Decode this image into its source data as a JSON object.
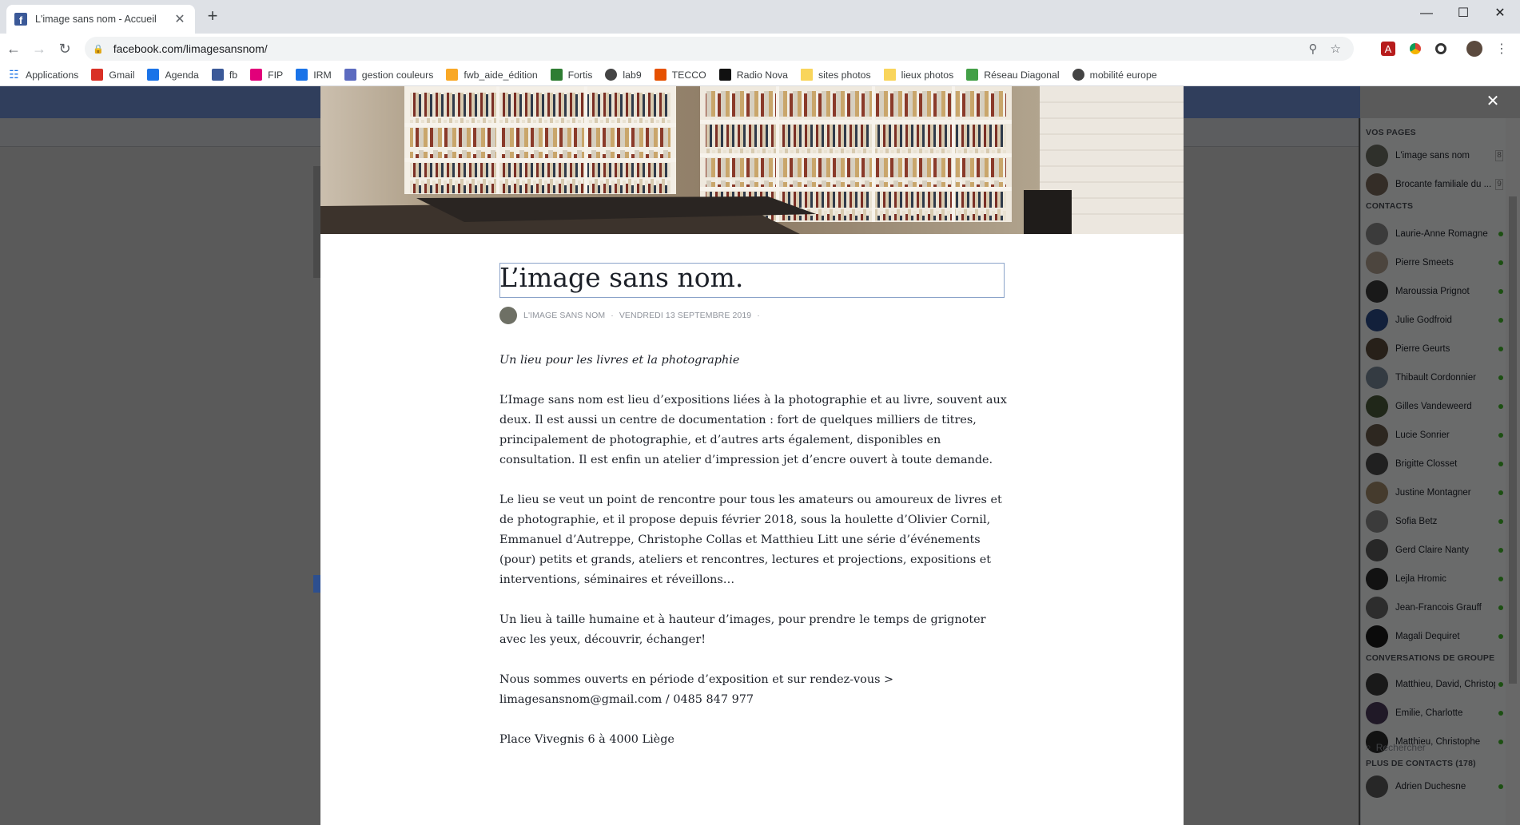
{
  "browser": {
    "tab_title": "L'image sans nom - Accueil",
    "tab_close": "✕",
    "new_tab": "+",
    "url": "facebook.com/limagesansnom/",
    "window_controls": [
      "—",
      "☐",
      "✕"
    ]
  },
  "bookmarks": [
    {
      "label": "Applications",
      "icon": "apps-grid-icon",
      "color": "#1a73e8"
    },
    {
      "label": "Gmail",
      "icon": "gmail-icon",
      "color": "#d93025"
    },
    {
      "label": "Agenda",
      "icon": "calendar-icon",
      "color": "#1a73e8"
    },
    {
      "label": "fb",
      "icon": "facebook-icon",
      "color": "#3b5998"
    },
    {
      "label": "FIP",
      "icon": "fip-icon",
      "color": "#e2007a"
    },
    {
      "label": "IRM",
      "icon": "irm-icon",
      "color": "#1a73e8"
    },
    {
      "label": "gestion couleurs",
      "icon": "gmg-icon",
      "color": "#5c6bc0"
    },
    {
      "label": "fwb_aide_édition",
      "icon": "fwb-icon",
      "color": "#f9a825"
    },
    {
      "label": "Fortis",
      "icon": "fortis-icon",
      "color": "#2e7d32"
    },
    {
      "label": "lab9",
      "icon": "globe-icon",
      "color": "#444"
    },
    {
      "label": "TECCO",
      "icon": "tecco-icon",
      "color": "#e65100"
    },
    {
      "label": "Radio Nova",
      "icon": "nova-icon",
      "color": "#111"
    },
    {
      "label": "sites photos",
      "icon": "folder-icon",
      "color": "#f9d55b"
    },
    {
      "label": "lieux photos",
      "icon": "folder-icon",
      "color": "#f9d55b"
    },
    {
      "label": "Réseau Diagonal",
      "icon": "diagonal-icon",
      "color": "#43a047"
    },
    {
      "label": "mobilité europe",
      "icon": "globe-icon",
      "color": "#444"
    }
  ],
  "article": {
    "title": "L’image sans nom.",
    "author": "L'IMAGE SANS NOM",
    "separator": "·",
    "date": "VENDREDI 13 SEPTEMBRE 2019",
    "subtitle": "Un lieu pour les livres et la photographie",
    "paragraphs": [
      "L’Image sans nom est lieu d’expositions liées à la photographie et au livre, souvent aux deux. Il est aussi un centre de documentation : fort de quelques milliers de titres, principalement de photographie, et d’autres arts également, disponibles en consultation. Il est enfin un atelier d’impression jet d’encre ouvert à toute demande.",
      "Le lieu se veut un point de rencontre pour tous les amateurs ou amoureux de livres et de photographie, et il propose depuis février 2018, sous la houlette d’Olivier Cornil, Emmanuel d’Autreppe, Christophe Collas et Matthieu Litt une série d’événements (pour) petits et grands, ateliers et rencontres, lectures et projections, expositions et interventions, séminaires et réveillons…",
      "Un lieu à taille humaine et à hauteur d’images, pour prendre le temps de grignoter avec les yeux, découvrir, échanger!",
      "Nous sommes ouverts en période d’exposition et sur rendez-vous > limagesansnom@gmail.com / 0485 847 977",
      "Place Vivegnis 6 à 4000 Liège"
    ]
  },
  "overlay": {
    "close": "✕"
  },
  "sidebar": {
    "pages_header": "VOS PAGES",
    "pages": [
      {
        "name": "L'image sans nom",
        "badge": "8",
        "color": "#6e7065"
      },
      {
        "name": "Brocante familiale du ...",
        "badge": "9",
        "color": "#7a6a5a"
      }
    ],
    "contacts_header": "CONTACTS",
    "contacts": [
      {
        "name": "Laurie-Anne Romagne",
        "color": "#8a8a8a"
      },
      {
        "name": "Pierre Smeets",
        "color": "#b0a090"
      },
      {
        "name": "Maroussia Prignot",
        "color": "#3a3a3a"
      },
      {
        "name": "Julie Godfroid",
        "color": "#2a4a8a"
      },
      {
        "name": "Pierre Geurts",
        "color": "#5a4a3a"
      },
      {
        "name": "Thibault Cordonnier",
        "color": "#7a8a9a"
      },
      {
        "name": "Gilles Vandeweerd",
        "color": "#4a5a3a"
      },
      {
        "name": "Lucie Sonrier",
        "color": "#6a5a4a"
      },
      {
        "name": "Brigitte Closset",
        "color": "#4a4a4a"
      },
      {
        "name": "Justine Montagner",
        "color": "#a08a6a"
      },
      {
        "name": "Sofia Betz",
        "color": "#8a8a8a"
      },
      {
        "name": "Gerd Claire Nanty",
        "color": "#5a5a5a"
      },
      {
        "name": "Lejla Hromic",
        "color": "#2a2a2a"
      },
      {
        "name": "Jean-Francois Grauff",
        "color": "#6a6a6a"
      },
      {
        "name": "Magali Dequiret",
        "color": "#1a1a1a"
      }
    ],
    "groups_header": "CONVERSATIONS DE GROUPE",
    "groups": [
      {
        "name": "Matthieu, David, Christophe",
        "color": "#3a3a3a"
      },
      {
        "name": "Emilie, Charlotte",
        "color": "#4a3a5a"
      },
      {
        "name": "Matthieu, Christophe",
        "color": "#2a2a2a"
      }
    ],
    "more_header": "PLUS DE CONTACTS (178)",
    "more": [
      {
        "name": "Adrien Duchesne",
        "color": "#5a5a5a"
      }
    ],
    "search_placeholder": "Rechercher"
  }
}
